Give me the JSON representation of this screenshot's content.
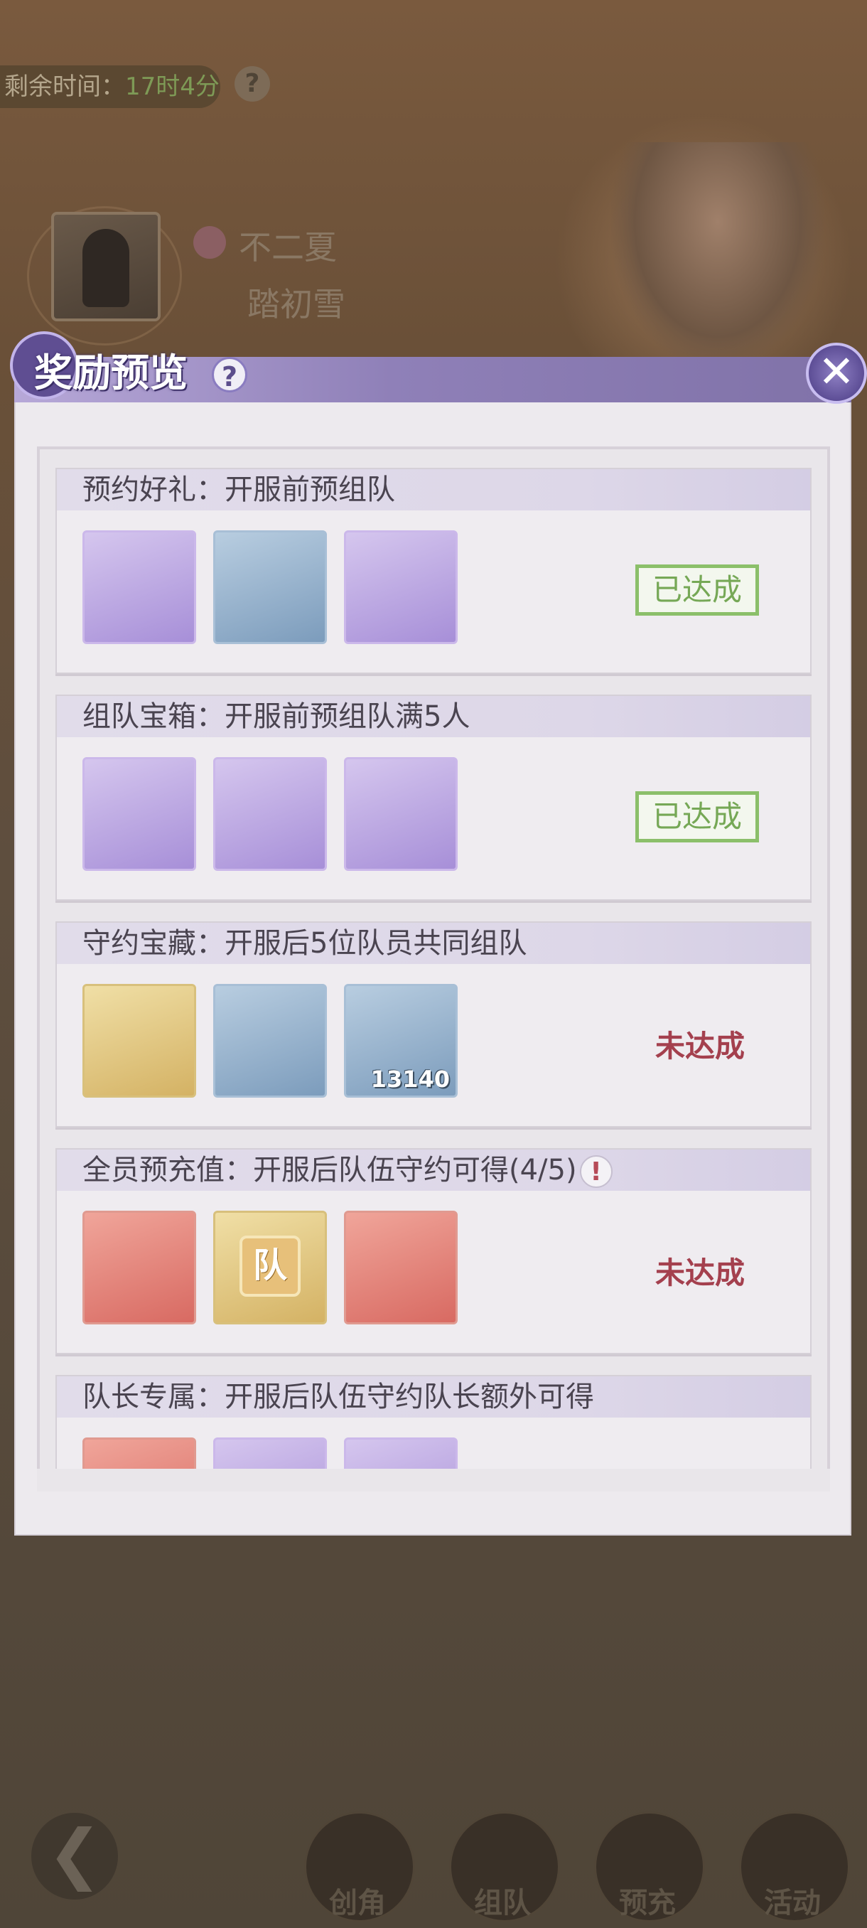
{
  "background": {
    "timer_label": "剩余时间：",
    "timer_value": "17时4分",
    "help_glyph": "?",
    "player_name_1": "不二夏",
    "player_name_2": "踏初雪",
    "nav": [
      {
        "label": "创角"
      },
      {
        "label": "组队"
      },
      {
        "label": "预充"
      },
      {
        "label": "活动"
      }
    ],
    "back_glyph": "❮"
  },
  "modal": {
    "title": "奖励预览",
    "help_glyph": "?",
    "close_glyph": "✕",
    "cards": [
      {
        "title": "预约好礼：开服前预组队",
        "status": "已达成",
        "status_type": "done",
        "items": [
          {
            "icon": "book-icon",
            "bg": "purple"
          },
          {
            "icon": "gem-bag-icon",
            "bg": "blue"
          },
          {
            "icon": "gold-bag-icon",
            "bg": "purple"
          }
        ]
      },
      {
        "title": "组队宝箱：开服前预组队满5人",
        "status": "已达成",
        "status_type": "done",
        "items": [
          {
            "icon": "map-scroll-icon",
            "bg": "purple"
          },
          {
            "icon": "green-scroll-icon",
            "bg": "purple"
          },
          {
            "icon": "gold-bag-icon",
            "bg": "purple"
          }
        ]
      },
      {
        "title": "守约宝藏：开服后5位队员共同组队",
        "status": "未达成",
        "status_type": "pending",
        "items": [
          {
            "icon": "photo-frame-icon",
            "bg": "gold"
          },
          {
            "icon": "yellow-flower-icon",
            "bg": "blue"
          },
          {
            "icon": "coin-icon",
            "bg": "blue",
            "qty": "13140"
          }
        ]
      },
      {
        "title": "全员预充值：开服后队伍守约可得(4/5)",
        "warn_glyph": "!",
        "status": "未达成",
        "status_type": "pending",
        "items": [
          {
            "icon": "outfit-icon",
            "bg": "red"
          },
          {
            "icon": "team-badge-icon",
            "bg": "gold",
            "badge_text": "队"
          },
          {
            "icon": "chibi-chest-icon",
            "bg": "red"
          }
        ]
      },
      {
        "title": "队长专属：开服后队伍守约队长额外可得",
        "items": [
          {
            "icon": "crown-icon",
            "bg": "red"
          },
          {
            "icon": "purple-item-icon",
            "bg": "purple"
          },
          {
            "icon": "gold-bag-icon",
            "bg": "purple"
          }
        ]
      }
    ]
  },
  "colors": {
    "done_green": "#76a856",
    "pending_red": "#a4404e",
    "header_purple": "#8f80b8"
  }
}
